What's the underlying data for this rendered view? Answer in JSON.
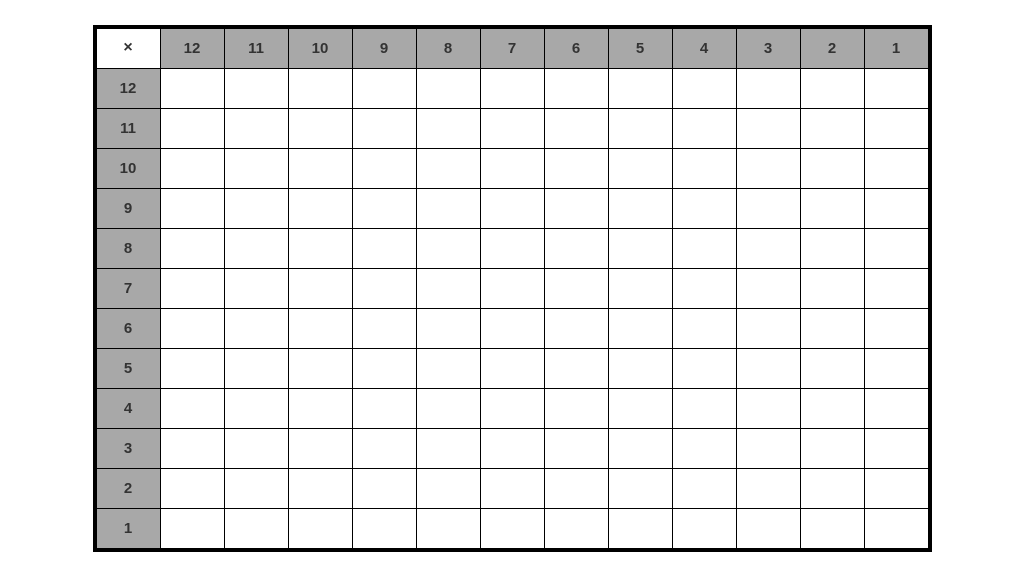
{
  "chart_data": {
    "type": "table",
    "title": "",
    "corner_symbol": "×",
    "column_headers": [
      "12",
      "11",
      "10",
      "9",
      "8",
      "7",
      "6",
      "5",
      "4",
      "3",
      "2",
      "1"
    ],
    "row_headers": [
      "12",
      "11",
      "10",
      "9",
      "8",
      "7",
      "6",
      "5",
      "4",
      "3",
      "2",
      "1"
    ],
    "cells": [
      [
        "",
        "",
        "",
        "",
        "",
        "",
        "",
        "",
        "",
        "",
        "",
        ""
      ],
      [
        "",
        "",
        "",
        "",
        "",
        "",
        "",
        "",
        "",
        "",
        "",
        ""
      ],
      [
        "",
        "",
        "",
        "",
        "",
        "",
        "",
        "",
        "",
        "",
        "",
        ""
      ],
      [
        "",
        "",
        "",
        "",
        "",
        "",
        "",
        "",
        "",
        "",
        "",
        ""
      ],
      [
        "",
        "",
        "",
        "",
        "",
        "",
        "",
        "",
        "",
        "",
        "",
        ""
      ],
      [
        "",
        "",
        "",
        "",
        "",
        "",
        "",
        "",
        "",
        "",
        "",
        ""
      ],
      [
        "",
        "",
        "",
        "",
        "",
        "",
        "",
        "",
        "",
        "",
        "",
        ""
      ],
      [
        "",
        "",
        "",
        "",
        "",
        "",
        "",
        "",
        "",
        "",
        "",
        ""
      ],
      [
        "",
        "",
        "",
        "",
        "",
        "",
        "",
        "",
        "",
        "",
        "",
        ""
      ],
      [
        "",
        "",
        "",
        "",
        "",
        "",
        "",
        "",
        "",
        "",
        "",
        ""
      ],
      [
        "",
        "",
        "",
        "",
        "",
        "",
        "",
        "",
        "",
        "",
        "",
        ""
      ],
      [
        "",
        "",
        "",
        "",
        "",
        "",
        "",
        "",
        "",
        "",
        "",
        ""
      ]
    ]
  }
}
